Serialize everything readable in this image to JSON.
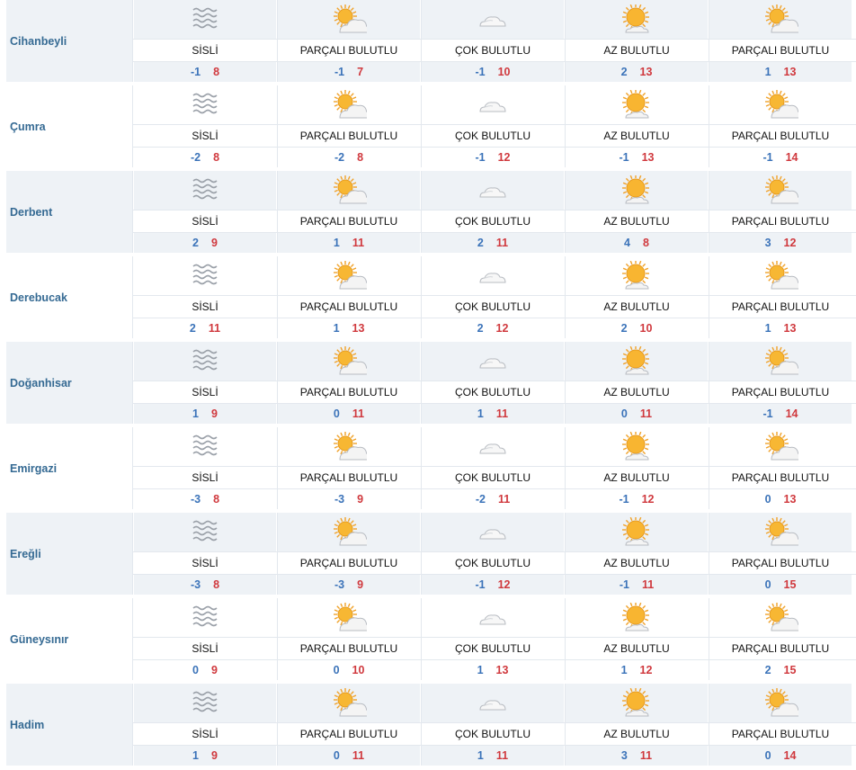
{
  "icons": {
    "SİSLİ": "fog-icon",
    "PARÇALI BULUTLU": "partly-cloudy-icon",
    "ÇOK BULUTLU": "mostly-cloudy-icon",
    "AZ BULUTLU": "mostly-sunny-icon"
  },
  "colors": {
    "min": "#3b73b9",
    "max": "#d0393e",
    "city": "#356a93",
    "band": "#eef2f6"
  },
  "rows": [
    {
      "city": "Cihanbeyli",
      "days": [
        {
          "cond": "SİSLİ",
          "min": "-1",
          "max": "8"
        },
        {
          "cond": "PARÇALI BULUTLU",
          "min": "-1",
          "max": "7"
        },
        {
          "cond": "ÇOK BULUTLU",
          "min": "-1",
          "max": "10"
        },
        {
          "cond": "AZ BULUTLU",
          "min": "2",
          "max": "13"
        },
        {
          "cond": "PARÇALI BULUTLU",
          "min": "1",
          "max": "13"
        }
      ]
    },
    {
      "city": "Çumra",
      "days": [
        {
          "cond": "SİSLİ",
          "min": "-2",
          "max": "8"
        },
        {
          "cond": "PARÇALI BULUTLU",
          "min": "-2",
          "max": "8"
        },
        {
          "cond": "ÇOK BULUTLU",
          "min": "-1",
          "max": "12"
        },
        {
          "cond": "AZ BULUTLU",
          "min": "-1",
          "max": "13"
        },
        {
          "cond": "PARÇALI BULUTLU",
          "min": "-1",
          "max": "14"
        }
      ]
    },
    {
      "city": "Derbent",
      "days": [
        {
          "cond": "SİSLİ",
          "min": "2",
          "max": "9"
        },
        {
          "cond": "PARÇALI BULUTLU",
          "min": "1",
          "max": "11"
        },
        {
          "cond": "ÇOK BULUTLU",
          "min": "2",
          "max": "11"
        },
        {
          "cond": "AZ BULUTLU",
          "min": "4",
          "max": "8"
        },
        {
          "cond": "PARÇALI BULUTLU",
          "min": "3",
          "max": "12"
        }
      ]
    },
    {
      "city": "Derebucak",
      "days": [
        {
          "cond": "SİSLİ",
          "min": "2",
          "max": "11"
        },
        {
          "cond": "PARÇALI BULUTLU",
          "min": "1",
          "max": "13"
        },
        {
          "cond": "ÇOK BULUTLU",
          "min": "2",
          "max": "12"
        },
        {
          "cond": "AZ BULUTLU",
          "min": "2",
          "max": "10"
        },
        {
          "cond": "PARÇALI BULUTLU",
          "min": "1",
          "max": "13"
        }
      ]
    },
    {
      "city": "Doğanhisar",
      "days": [
        {
          "cond": "SİSLİ",
          "min": "1",
          "max": "9"
        },
        {
          "cond": "PARÇALI BULUTLU",
          "min": "0",
          "max": "11"
        },
        {
          "cond": "ÇOK BULUTLU",
          "min": "1",
          "max": "11"
        },
        {
          "cond": "AZ BULUTLU",
          "min": "0",
          "max": "11"
        },
        {
          "cond": "PARÇALI BULUTLU",
          "min": "-1",
          "max": "14"
        }
      ]
    },
    {
      "city": "Emirgazi",
      "days": [
        {
          "cond": "SİSLİ",
          "min": "-3",
          "max": "8"
        },
        {
          "cond": "PARÇALI BULUTLU",
          "min": "-3",
          "max": "9"
        },
        {
          "cond": "ÇOK BULUTLU",
          "min": "-2",
          "max": "11"
        },
        {
          "cond": "AZ BULUTLU",
          "min": "-1",
          "max": "12"
        },
        {
          "cond": "PARÇALI BULUTLU",
          "min": "0",
          "max": "13"
        }
      ]
    },
    {
      "city": "Ereğli",
      "days": [
        {
          "cond": "SİSLİ",
          "min": "-3",
          "max": "8"
        },
        {
          "cond": "PARÇALI BULUTLU",
          "min": "-3",
          "max": "9"
        },
        {
          "cond": "ÇOK BULUTLU",
          "min": "-1",
          "max": "12"
        },
        {
          "cond": "AZ BULUTLU",
          "min": "-1",
          "max": "11"
        },
        {
          "cond": "PARÇALI BULUTLU",
          "min": "0",
          "max": "15"
        }
      ]
    },
    {
      "city": "Güneysınır",
      "days": [
        {
          "cond": "SİSLİ",
          "min": "0",
          "max": "9"
        },
        {
          "cond": "PARÇALI BULUTLU",
          "min": "0",
          "max": "10"
        },
        {
          "cond": "ÇOK BULUTLU",
          "min": "1",
          "max": "13"
        },
        {
          "cond": "AZ BULUTLU",
          "min": "1",
          "max": "12"
        },
        {
          "cond": "PARÇALI BULUTLU",
          "min": "2",
          "max": "15"
        }
      ]
    },
    {
      "city": "Hadim",
      "days": [
        {
          "cond": "SİSLİ",
          "min": "1",
          "max": "9"
        },
        {
          "cond": "PARÇALI BULUTLU",
          "min": "0",
          "max": "11"
        },
        {
          "cond": "ÇOK BULUTLU",
          "min": "1",
          "max": "11"
        },
        {
          "cond": "AZ BULUTLU",
          "min": "3",
          "max": "11"
        },
        {
          "cond": "PARÇALI BULUTLU",
          "min": "0",
          "max": "14"
        }
      ]
    }
  ]
}
